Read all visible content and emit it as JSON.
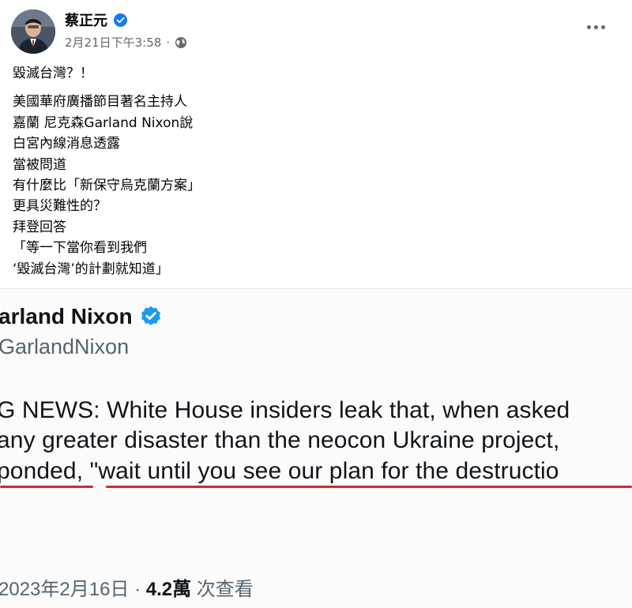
{
  "post": {
    "author": "蔡正元",
    "timestamp": "2月21日下午3:58",
    "separator": "·",
    "audience_icon": "globe-icon",
    "more_icon": "more-options-icon",
    "text_first": "毀滅台灣？！",
    "text_lines": [
      "美國華府廣播節目著名主持人",
      "嘉蘭 尼克森Garland Nixon說",
      "白宮內線消息透露",
      "當被問道",
      "有什麼比「新保守烏克蘭方案」",
      "更具災難性的？",
      "拜登回答",
      "「等一下當你看到我們",
      "‘毀滅台灣’的計劃就知道」"
    ]
  },
  "embed": {
    "name": "arland Nixon",
    "handle": "GarlandNixon",
    "lines": [
      "G NEWS: White House insiders leak that, when asked",
      "any greater disaster than the neocon Ukraine project,",
      "ponded, \"wait until you see our plan for the destructio"
    ],
    "footer_date": "2023年2月16日",
    "footer_sep": " · ",
    "footer_views": "4.2萬",
    "footer_views_label": " 次查看"
  },
  "colors": {
    "verified_blue": "#1877f2",
    "twitter_verified": "#1d9bf0",
    "underline_red": "#d7262f",
    "meta_gray": "#65676b"
  }
}
